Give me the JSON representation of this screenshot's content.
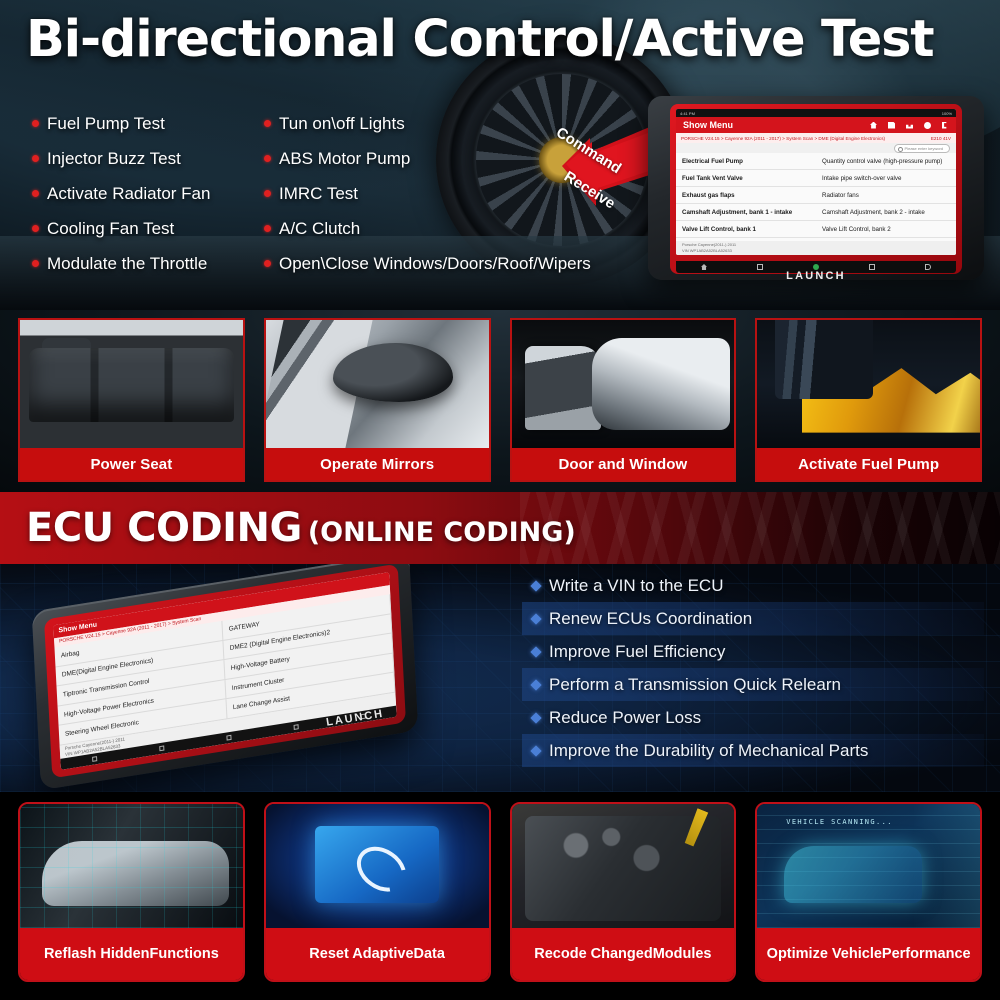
{
  "hero": {
    "title": "Bi-directional Control/Active Test",
    "bullets_left": [
      "Fuel Pump Test",
      "Injector Buzz Test",
      "Activate Radiator Fan",
      "Cooling Fan Test",
      "Modulate the Throttle"
    ],
    "bullets_right": [
      "Tun on\\off Lights",
      "ABS Motor Pump",
      "IMRC Test",
      "A/C Clutch",
      "Open\\Close Windows/Doors/Roof/Wipers"
    ],
    "arrow_command": "Command",
    "arrow_receive": "Receive"
  },
  "tablet_hero": {
    "status_left": "4:41 PM",
    "status_right": "100%",
    "toolbar_title": "Show Menu",
    "toolbar_icons": [
      "home-icon",
      "note-icon",
      "upload-icon",
      "help-icon",
      "exit-icon"
    ],
    "breadcrumb": "PORSCHE V24.15 > Cayenne 92A (2011 - 2017) > System Scan > DME (Digital Engine Electronics)",
    "breadcrumb_code": "E210 41V",
    "search_placeholder": "Please enter keyword",
    "rows": [
      {
        "left": "Electrical Fuel Pump",
        "right": "Quantity control valve (high-pressure pump)"
      },
      {
        "left": "Fuel Tank Vent Valve",
        "right": "Intake pipe switch-over valve"
      },
      {
        "left": "Exhaust gas flaps",
        "right": "Radiator fans"
      },
      {
        "left": "Camshaft Adjustment, bank 1 - intake",
        "right": "Camshaft Adjustment, bank 2 - intake"
      },
      {
        "left": "Valve Lift Control, bank 1",
        "right": "Valve Lift Control, bank 2"
      }
    ],
    "info_line1": "Porsche Cayenne(2011-) 2011",
    "info_line2": "VIN WP1AB2A52BLA52633",
    "nav_icons": [
      "home-icon",
      "recents-icon",
      "record-icon",
      "screenshot-icon",
      "back-icon"
    ],
    "brand": "LAUNCH"
  },
  "cards_top": [
    {
      "label": "Power Seat",
      "image": "car-rear-seats-photo"
    },
    {
      "label": "Operate Mirrors",
      "image": "side-mirror-photo"
    },
    {
      "label": "Door and Window",
      "image": "open-car-door-photo"
    },
    {
      "label": "Activate Fuel Pump",
      "image": "pistons-fuel-photo"
    }
  ],
  "ecu": {
    "banner_title": "ECU CODING",
    "banner_subtitle": "(ONLINE CODING)",
    "features": [
      {
        "text": "Write a VIN to the ECU",
        "highlighted": false
      },
      {
        "text": "Renew ECUs Coordination",
        "highlighted": true
      },
      {
        "text": "Improve Fuel Efficiency",
        "highlighted": false
      },
      {
        "text": "Perform a Transmission Quick Relearn",
        "highlighted": true
      },
      {
        "text": "Reduce Power Loss",
        "highlighted": false
      },
      {
        "text": "Improve the Durability of Mechanical Parts",
        "highlighted": true
      }
    ]
  },
  "tablet_ecu": {
    "toolbar_title": "Show Menu",
    "breadcrumb": "PORSCHE V24.15 > Cayenne 92A (2011 - 2017) > System Scan",
    "cells": [
      "Airbag",
      "GATEWAY",
      "DME(Digital Engine Electronics)",
      "DME2 (Digital Engine Electronics)2",
      "Tiptronic Transmission Control",
      "High-Voltage Battery",
      "High-Voltage Power Electronics",
      "Instrument Cluster",
      "Steering Wheel Electronic",
      "Lane Change Assist"
    ],
    "info_line1": "Porsche Cayenne(2011-) 2011",
    "info_line2": "VIN WP1AB2A52BLA52633",
    "brand": "LAUNCH"
  },
  "cards_bottom": [
    {
      "label": "Reflash Hidden\nFunctions",
      "line1": "Reflash Hidden",
      "line2": "Functions",
      "image": "car-hologram-locks-photo"
    },
    {
      "label": "Reset Adaptive\nData",
      "line1": "Reset Adaptive",
      "line2": "Data",
      "image": "chip-refresh-icon-photo"
    },
    {
      "label": "Recode Changed\nModules",
      "line1": "Recode Changed",
      "line2": "Modules",
      "image": "engine-bay-photo"
    },
    {
      "label": "Optimize Vehicle\nPerformance",
      "line1": "Optimize Vehicle",
      "line2": "Performance",
      "image": "vehicle-scanning-hud-photo",
      "hud_caption": "VEHICLE SCANNING..."
    }
  ],
  "colors": {
    "brand_red": "#cf0d14",
    "banner_red": "#b50f14",
    "bullet_red": "#e02020",
    "feature_blue": "#4a7fd6"
  }
}
